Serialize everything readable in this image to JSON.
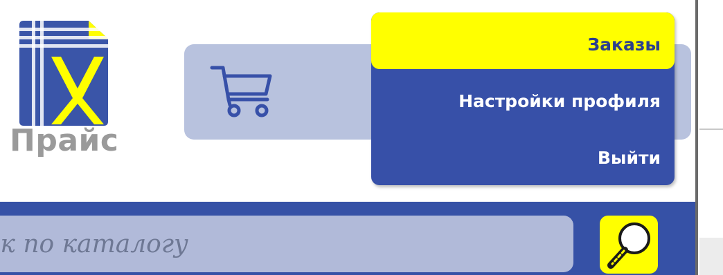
{
  "logo": {
    "text": "Прайс",
    "icon": "price-list-x-icon",
    "colors": {
      "blue": "#3a55a8",
      "yellow": "#ffff00",
      "text": "#9a9a9a"
    }
  },
  "cart": {
    "icon": "shopping-cart-icon",
    "panel_color": "#b8c2de",
    "icon_color": "#3750a8"
  },
  "menu": {
    "items": [
      {
        "label": "Заказы",
        "active": true
      },
      {
        "label": "Настройки профиля",
        "active": false
      },
      {
        "label": "Выйти",
        "active": false
      }
    ],
    "bg_color": "#3750a8",
    "active_color": "#ffff00"
  },
  "search": {
    "placeholder": "Поиск по каталогу",
    "button_icon": "magnifier-icon",
    "bar_color": "#3651a6",
    "input_color": "#b1bad9",
    "button_color": "#ffff00"
  }
}
